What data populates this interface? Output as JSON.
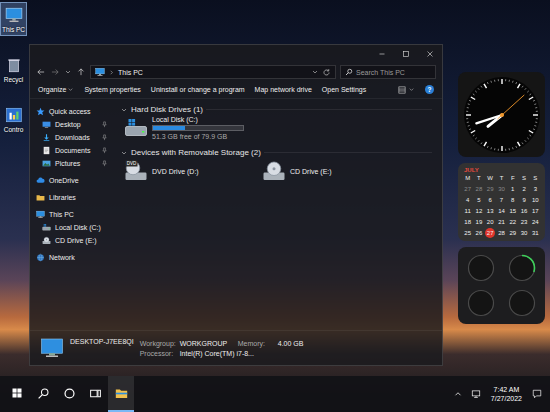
{
  "desktop": {
    "icons": [
      {
        "label": "This PC",
        "kind": "pc",
        "selected": true
      },
      {
        "label": "Recycl",
        "kind": "recycle",
        "selected": false
      },
      {
        "label": "Contro",
        "kind": "control",
        "selected": false
      }
    ]
  },
  "window": {
    "title": "This PC",
    "search": {
      "placeholder": "Search This PC"
    },
    "toolbar": [
      {
        "label": "Organize",
        "kind": "menu"
      },
      {
        "label": "System properties",
        "kind": "button"
      },
      {
        "label": "Uninstall or change a program",
        "kind": "button"
      },
      {
        "label": "Map network drive",
        "kind": "button"
      },
      {
        "label": "Open Settings",
        "kind": "button"
      }
    ],
    "help": "?",
    "sidebar": [
      {
        "label": "Quick access",
        "kind": "quick",
        "pinned": false,
        "children": [
          {
            "label": "Desktop",
            "kind": "desktop",
            "pinned": true
          },
          {
            "label": "Downloads",
            "kind": "downloads",
            "pinned": true
          },
          {
            "label": "Documents",
            "kind": "documents",
            "pinned": true
          },
          {
            "label": "Pictures",
            "kind": "pictures",
            "pinned": true
          }
        ]
      },
      {
        "label": "OneDrive",
        "kind": "cloud",
        "pinned": false
      },
      {
        "label": "Libraries",
        "kind": "library",
        "pinned": false
      },
      {
        "label": "This PC",
        "kind": "pc",
        "pinned": false,
        "children": [
          {
            "label": "Local Disk (C:)",
            "kind": "disk",
            "pinned": false
          },
          {
            "label": "CD Drive (E:)",
            "kind": "cd",
            "pinned": false
          }
        ]
      },
      {
        "label": "Network",
        "kind": "network",
        "pinned": false
      }
    ],
    "sections": [
      {
        "title": "Hard Disk Drives (1)",
        "drives": [
          {
            "label": "Local Disk (C:)",
            "kind": "disk",
            "level": 0.36,
            "free": "51.3 GB free of 79.9 GB"
          }
        ]
      },
      {
        "title": "Devices with Removable Storage (2)",
        "drives": [
          {
            "label": "DVD Drive (D:)",
            "kind": "dvd",
            "badge": "DVD"
          },
          {
            "label": "CD Drive (E:)",
            "kind": "cd"
          }
        ]
      }
    ],
    "details": {
      "computer": "DESKTOP-J7EE8QI",
      "rows": [
        [
          {
            "label": "Workgroup:",
            "value": "WORKGROUP"
          },
          {
            "label": "Memory:",
            "value": "4.00 GB"
          }
        ],
        [
          {
            "label": "Processor:",
            "value": "Intel(R) Core(TM) i7-8..."
          }
        ]
      ]
    }
  },
  "widgets": {
    "clock": {
      "hour": 7,
      "minute": 42,
      "second": 8
    },
    "calendar": {
      "month": "JULY",
      "weekdays": [
        "M",
        "T",
        "W",
        "T",
        "F",
        "S",
        "S"
      ],
      "days": [
        {
          "day": "27",
          "muted": true,
          "today": false
        },
        {
          "day": "28",
          "muted": true,
          "today": false
        },
        {
          "day": "29",
          "muted": true,
          "today": false
        },
        {
          "day": "30",
          "muted": true,
          "today": false
        },
        {
          "day": "1",
          "muted": false,
          "today": false
        },
        {
          "day": "2",
          "muted": false,
          "today": false
        },
        {
          "day": "3",
          "muted": false,
          "today": false
        },
        {
          "day": "4",
          "muted": false,
          "today": false
        },
        {
          "day": "5",
          "muted": false,
          "today": false
        },
        {
          "day": "6",
          "muted": false,
          "today": false
        },
        {
          "day": "7",
          "muted": false,
          "today": false
        },
        {
          "day": "8",
          "muted": false,
          "today": false
        },
        {
          "day": "9",
          "muted": false,
          "today": false
        },
        {
          "day": "10",
          "muted": false,
          "today": false
        },
        {
          "day": "11",
          "muted": false,
          "today": false
        },
        {
          "day": "12",
          "muted": false,
          "today": false
        },
        {
          "day": "13",
          "muted": false,
          "today": false
        },
        {
          "day": "14",
          "muted": false,
          "today": false
        },
        {
          "day": "15",
          "muted": false,
          "today": false
        },
        {
          "day": "16",
          "muted": false,
          "today": false
        },
        {
          "day": "17",
          "muted": false,
          "today": false
        },
        {
          "day": "18",
          "muted": false,
          "today": false
        },
        {
          "day": "19",
          "muted": false,
          "today": false
        },
        {
          "day": "20",
          "muted": false,
          "today": false
        },
        {
          "day": "21",
          "muted": false,
          "today": false
        },
        {
          "day": "22",
          "muted": false,
          "today": false
        },
        {
          "day": "23",
          "muted": false,
          "today": false
        },
        {
          "day": "24",
          "muted": false,
          "today": false
        },
        {
          "day": "25",
          "muted": false,
          "today": false
        },
        {
          "day": "26",
          "muted": false,
          "today": false
        },
        {
          "day": "27",
          "muted": false,
          "today": true
        },
        {
          "day": "28",
          "muted": false,
          "today": false
        },
        {
          "day": "29",
          "muted": false,
          "today": false
        },
        {
          "day": "30",
          "muted": false,
          "today": false
        },
        {
          "day": "31",
          "muted": false,
          "today": false
        }
      ]
    },
    "gauges": [
      {
        "kind": "cpu",
        "level": 0
      },
      {
        "kind": "memory",
        "level": 0.3
      },
      {
        "kind": "hdd",
        "level": 0
      },
      {
        "kind": "globe",
        "level": 0
      }
    ]
  },
  "taskbar": {
    "apps": [
      {
        "kind": "start",
        "active": false
      },
      {
        "kind": "search",
        "active": false
      },
      {
        "kind": "cortana",
        "active": false
      },
      {
        "kind": "taskview",
        "active": false
      },
      {
        "kind": "explorer",
        "active": true
      }
    ],
    "tray": [
      {
        "kind": "chevron"
      },
      {
        "kind": "traynet"
      }
    ],
    "time": "7:42 AM",
    "date": "7/27/2022",
    "notification": {
      "kind": "notification"
    }
  }
}
